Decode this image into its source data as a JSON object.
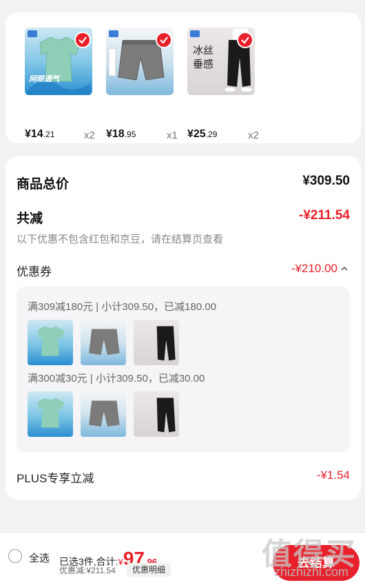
{
  "products": [
    {
      "price_int": "¥14",
      "price_dec": ".21",
      "qty": "x2",
      "overlay_text": "网眼透气"
    },
    {
      "price_int": "¥18",
      "price_dec": ".95",
      "qty": "x1",
      "overlay_text": ""
    },
    {
      "price_int": "¥25",
      "price_dec": ".29",
      "qty": "x2",
      "overlay_text": "冰丝垂感"
    }
  ],
  "summary": {
    "total_label": "商品总价",
    "total_value": "¥309.50",
    "reduce_label": "共减",
    "reduce_value": "-¥211.54",
    "note": "以下优惠不包含红包和京豆，请在结算页查看",
    "coupon_label": "优惠券",
    "coupon_value": "-¥210.00",
    "coupon_groups": [
      {
        "title": "满309减180元 | 小计309.50，已减180.00"
      },
      {
        "title": "满300减30元 | 小计309.50，已减30.00"
      }
    ],
    "plus_label": "PLUS专享立减",
    "plus_value": "-¥1.54"
  },
  "bottom": {
    "select_all": "全选",
    "selected_text": "已选3件,合计:",
    "currency": "¥",
    "total_int": "97",
    "total_dec": ".96",
    "discount_text": "优惠减:¥211.54",
    "detail_button": "优惠明细",
    "checkout_button": "去结算"
  },
  "watermark": {
    "logo": "值得买",
    "url": "zhizhizhi.com"
  },
  "colors": {
    "accent": "#e8202b",
    "background": "#f2f2f2"
  }
}
